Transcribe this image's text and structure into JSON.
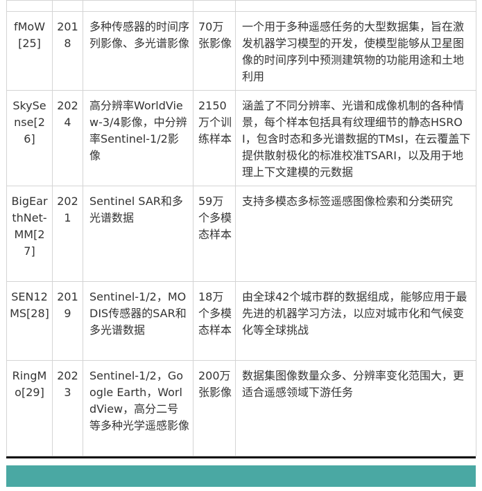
{
  "table": {
    "rows": [
      {
        "name": "fMoW[25]",
        "year": "2018",
        "data": "多种传感器的时间序列影像、多光谱影像",
        "count": "70万张影像",
        "desc": "一个用于多种遥感任务的大型数据集，旨在激发机器学习模型的开发，使模型能够从卫星图像的时间序列中预测建筑物的功能用途和土地利用"
      },
      {
        "name": "SkySense[26]",
        "year": "2024",
        "data": "高分辨率WorldView-3/4影像，中分辨率Sentinel-1/2影像",
        "count": "2150万个训练样本",
        "desc": "涵盖了不同分辨率、光谱和成像机制的各种情景，每个样本包括具有纹理细节的静态HSROI，包含时态和多光谱数据的TMsI，在云覆盖下提供散射极化的标准校准TSARI，以及用于地理上下文建模的元数据"
      },
      {
        "name": "BigEarthNet-MM[27]",
        "year": "2021",
        "data": "Sentinel SAR和多光谱数据",
        "count": "59万个多模态样本",
        "desc": "支持多模态多标签遥感图像检索和分类研究"
      },
      {
        "name": "SEN12MS[28]",
        "year": "2019",
        "data": "Sentinel-1/2，MODIS传感器的SAR和多光谱数据",
        "count": "18万个多模态样本",
        "desc": "由全球42个城市群的数据组成，能够应用于最先进的机器学习方法，以应对城市化和气候变化等全球挑战"
      },
      {
        "name": "RingMo[29]",
        "year": "2023",
        "data": "Sentinel-1/2，Google Earth，WorldView，高分二号等多种光学遥感影像",
        "count": "200万张影像",
        "desc": "数据集图像数量众多、分辨率变化范围大，更适合遥感领域下游任务"
      }
    ]
  },
  "colors": {
    "border": "#d4d4d4",
    "text": "#333333",
    "rule": "#111111",
    "footer_bar": "#4aa8a3"
  }
}
